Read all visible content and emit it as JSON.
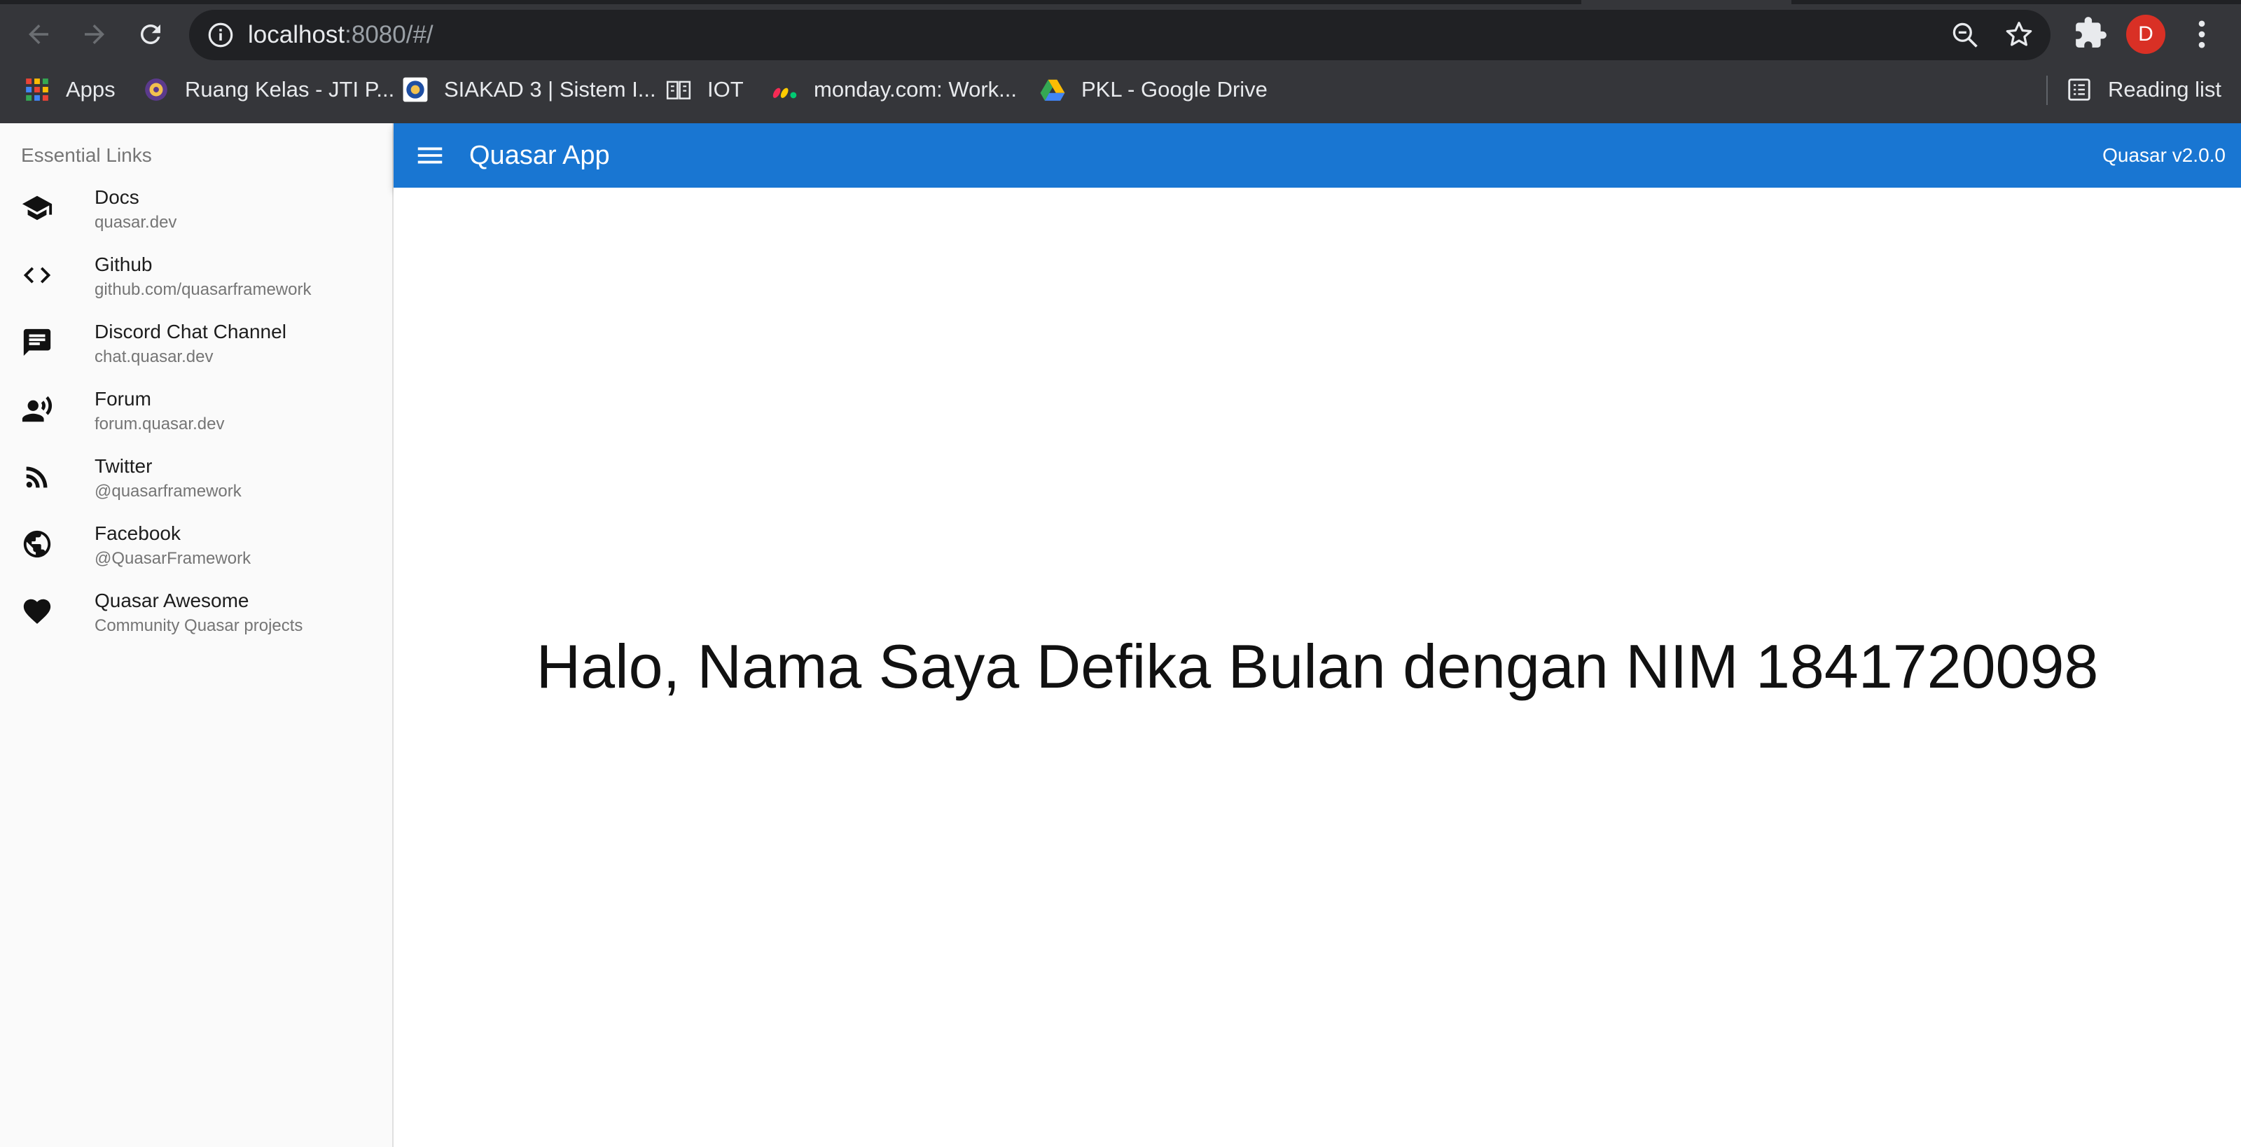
{
  "browser": {
    "url_host": "localhost",
    "url_rest": ":8080/#/",
    "profile_initial": "D",
    "bookmarks": [
      {
        "label": "Apps",
        "icon": "apps-grid-icon"
      },
      {
        "label": "Ruang Kelas - JTI P...",
        "icon": "polinema-logo-icon"
      },
      {
        "label": "SIAKAD 3 | Sistem I...",
        "icon": "siakad-logo-icon"
      },
      {
        "label": "IOT",
        "icon": "iot-book-icon"
      },
      {
        "label": "monday.com: Work...",
        "icon": "monday-logo-icon"
      },
      {
        "label": "PKL - Google Drive",
        "icon": "google-drive-icon"
      }
    ],
    "reading_list": "Reading list"
  },
  "drawer": {
    "header": "Essential Links",
    "items": [
      {
        "title": "Docs",
        "caption": "quasar.dev",
        "icon": "school-icon"
      },
      {
        "title": "Github",
        "caption": "github.com/quasarframework",
        "icon": "code-icon"
      },
      {
        "title": "Discord Chat Channel",
        "caption": "chat.quasar.dev",
        "icon": "chat-icon"
      },
      {
        "title": "Forum",
        "caption": "forum.quasar.dev",
        "icon": "record-voice-icon"
      },
      {
        "title": "Twitter",
        "caption": "@quasarframework",
        "icon": "rss-feed-icon"
      },
      {
        "title": "Facebook",
        "caption": "@QuasarFramework",
        "icon": "public-globe-icon"
      },
      {
        "title": "Quasar Awesome",
        "caption": "Community Quasar projects",
        "icon": "favorite-heart-icon"
      }
    ]
  },
  "header": {
    "title": "Quasar App",
    "version": "Quasar v2.0.0",
    "color": "#1976d2"
  },
  "main": {
    "greeting": "Halo, Nama Saya Defika Bulan dengan NIM 1841720098"
  }
}
